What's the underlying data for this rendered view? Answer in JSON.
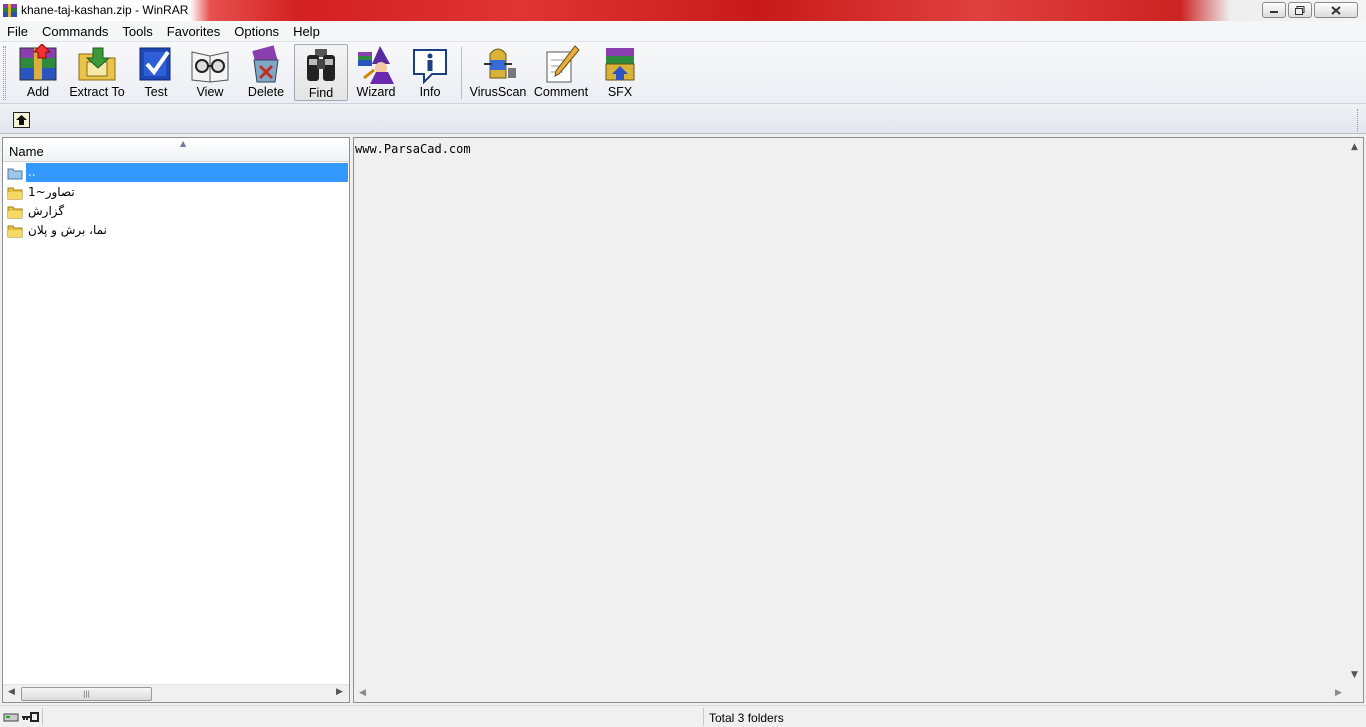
{
  "window": {
    "title": "khane-taj-kashan.zip - WinRAR",
    "controls": {
      "minimize": "minimize-icon",
      "maximize": "maximize-icon",
      "close": "close-icon"
    }
  },
  "menu": {
    "items": [
      "File",
      "Commands",
      "Tools",
      "Favorites",
      "Options",
      "Help"
    ]
  },
  "toolbar": {
    "buttons": [
      {
        "label": "Add",
        "icon": "add-archive-icon"
      },
      {
        "label": "Extract To",
        "icon": "extract-to-icon"
      },
      {
        "label": "Test",
        "icon": "test-icon"
      },
      {
        "label": "View",
        "icon": "view-icon"
      },
      {
        "label": "Delete",
        "icon": "delete-icon"
      },
      {
        "label": "Find",
        "icon": "find-binoculars-icon",
        "active": true
      },
      {
        "label": "Wizard",
        "icon": "wizard-icon"
      },
      {
        "label": "Info",
        "icon": "info-icon"
      },
      {
        "label": "VirusScan",
        "icon": "virus-scan-icon"
      },
      {
        "label": "Comment",
        "icon": "comment-icon"
      },
      {
        "label": "SFX",
        "icon": "sfx-icon"
      }
    ]
  },
  "addressbar": {
    "up_icon": "up-folder-icon"
  },
  "filelist": {
    "column_name": "Name",
    "rows": [
      {
        "name": "..",
        "type": "parent",
        "selected": true
      },
      {
        "name": "تصاور~1",
        "type": "folder"
      },
      {
        "name": "گزارش",
        "type": "folder"
      },
      {
        "name": "نما، برش و پلان",
        "type": "folder"
      }
    ]
  },
  "comment": {
    "text": "www.ParsaCad.com"
  },
  "status": {
    "text": "Total 3 folders"
  },
  "colors": {
    "selection": "#3399ff",
    "titlebar_red": "#d32020",
    "folder": "#e8c244"
  }
}
